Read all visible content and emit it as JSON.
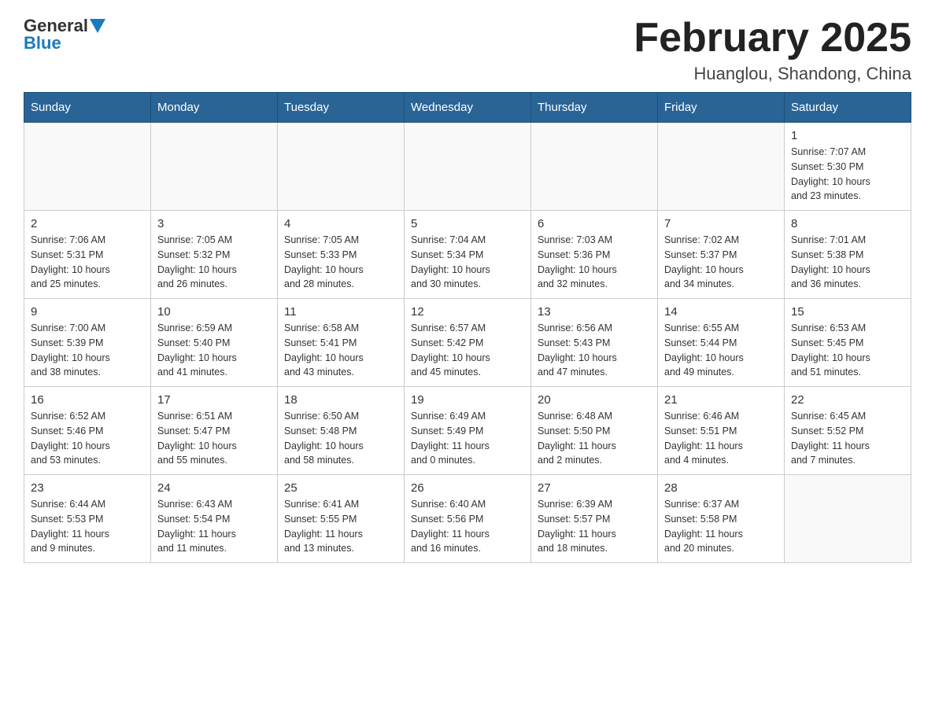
{
  "logo": {
    "general": "General",
    "blue": "Blue"
  },
  "title": "February 2025",
  "subtitle": "Huanglou, Shandong, China",
  "days_of_week": [
    "Sunday",
    "Monday",
    "Tuesday",
    "Wednesday",
    "Thursday",
    "Friday",
    "Saturday"
  ],
  "weeks": [
    [
      {
        "day": "",
        "info": ""
      },
      {
        "day": "",
        "info": ""
      },
      {
        "day": "",
        "info": ""
      },
      {
        "day": "",
        "info": ""
      },
      {
        "day": "",
        "info": ""
      },
      {
        "day": "",
        "info": ""
      },
      {
        "day": "1",
        "info": "Sunrise: 7:07 AM\nSunset: 5:30 PM\nDaylight: 10 hours\nand 23 minutes."
      }
    ],
    [
      {
        "day": "2",
        "info": "Sunrise: 7:06 AM\nSunset: 5:31 PM\nDaylight: 10 hours\nand 25 minutes."
      },
      {
        "day": "3",
        "info": "Sunrise: 7:05 AM\nSunset: 5:32 PM\nDaylight: 10 hours\nand 26 minutes."
      },
      {
        "day": "4",
        "info": "Sunrise: 7:05 AM\nSunset: 5:33 PM\nDaylight: 10 hours\nand 28 minutes."
      },
      {
        "day": "5",
        "info": "Sunrise: 7:04 AM\nSunset: 5:34 PM\nDaylight: 10 hours\nand 30 minutes."
      },
      {
        "day": "6",
        "info": "Sunrise: 7:03 AM\nSunset: 5:36 PM\nDaylight: 10 hours\nand 32 minutes."
      },
      {
        "day": "7",
        "info": "Sunrise: 7:02 AM\nSunset: 5:37 PM\nDaylight: 10 hours\nand 34 minutes."
      },
      {
        "day": "8",
        "info": "Sunrise: 7:01 AM\nSunset: 5:38 PM\nDaylight: 10 hours\nand 36 minutes."
      }
    ],
    [
      {
        "day": "9",
        "info": "Sunrise: 7:00 AM\nSunset: 5:39 PM\nDaylight: 10 hours\nand 38 minutes."
      },
      {
        "day": "10",
        "info": "Sunrise: 6:59 AM\nSunset: 5:40 PM\nDaylight: 10 hours\nand 41 minutes."
      },
      {
        "day": "11",
        "info": "Sunrise: 6:58 AM\nSunset: 5:41 PM\nDaylight: 10 hours\nand 43 minutes."
      },
      {
        "day": "12",
        "info": "Sunrise: 6:57 AM\nSunset: 5:42 PM\nDaylight: 10 hours\nand 45 minutes."
      },
      {
        "day": "13",
        "info": "Sunrise: 6:56 AM\nSunset: 5:43 PM\nDaylight: 10 hours\nand 47 minutes."
      },
      {
        "day": "14",
        "info": "Sunrise: 6:55 AM\nSunset: 5:44 PM\nDaylight: 10 hours\nand 49 minutes."
      },
      {
        "day": "15",
        "info": "Sunrise: 6:53 AM\nSunset: 5:45 PM\nDaylight: 10 hours\nand 51 minutes."
      }
    ],
    [
      {
        "day": "16",
        "info": "Sunrise: 6:52 AM\nSunset: 5:46 PM\nDaylight: 10 hours\nand 53 minutes."
      },
      {
        "day": "17",
        "info": "Sunrise: 6:51 AM\nSunset: 5:47 PM\nDaylight: 10 hours\nand 55 minutes."
      },
      {
        "day": "18",
        "info": "Sunrise: 6:50 AM\nSunset: 5:48 PM\nDaylight: 10 hours\nand 58 minutes."
      },
      {
        "day": "19",
        "info": "Sunrise: 6:49 AM\nSunset: 5:49 PM\nDaylight: 11 hours\nand 0 minutes."
      },
      {
        "day": "20",
        "info": "Sunrise: 6:48 AM\nSunset: 5:50 PM\nDaylight: 11 hours\nand 2 minutes."
      },
      {
        "day": "21",
        "info": "Sunrise: 6:46 AM\nSunset: 5:51 PM\nDaylight: 11 hours\nand 4 minutes."
      },
      {
        "day": "22",
        "info": "Sunrise: 6:45 AM\nSunset: 5:52 PM\nDaylight: 11 hours\nand 7 minutes."
      }
    ],
    [
      {
        "day": "23",
        "info": "Sunrise: 6:44 AM\nSunset: 5:53 PM\nDaylight: 11 hours\nand 9 minutes."
      },
      {
        "day": "24",
        "info": "Sunrise: 6:43 AM\nSunset: 5:54 PM\nDaylight: 11 hours\nand 11 minutes."
      },
      {
        "day": "25",
        "info": "Sunrise: 6:41 AM\nSunset: 5:55 PM\nDaylight: 11 hours\nand 13 minutes."
      },
      {
        "day": "26",
        "info": "Sunrise: 6:40 AM\nSunset: 5:56 PM\nDaylight: 11 hours\nand 16 minutes."
      },
      {
        "day": "27",
        "info": "Sunrise: 6:39 AM\nSunset: 5:57 PM\nDaylight: 11 hours\nand 18 minutes."
      },
      {
        "day": "28",
        "info": "Sunrise: 6:37 AM\nSunset: 5:58 PM\nDaylight: 11 hours\nand 20 minutes."
      },
      {
        "day": "",
        "info": ""
      }
    ]
  ]
}
